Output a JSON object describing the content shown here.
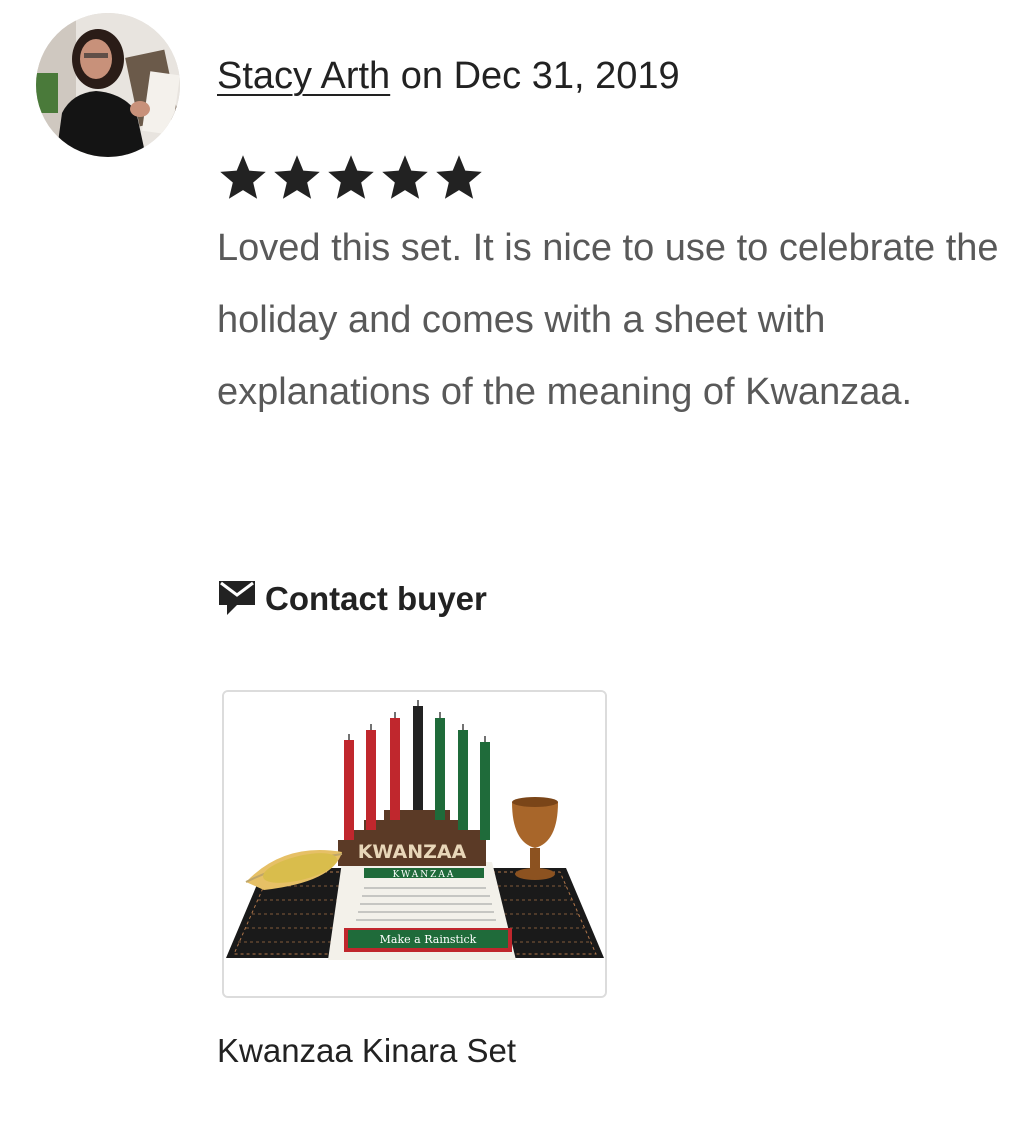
{
  "review": {
    "reviewer_name": "Stacy Arth",
    "date_text": " on Dec 31, 2019",
    "rating": 5,
    "rating_max": 5,
    "text": "Loved this set. It is nice to use to celebrate the holiday and comes with a sheet with explanations of the meaning of Kwanzaa.",
    "contact_label": "Contact buyer",
    "contact_icon": "message-icon"
  },
  "product": {
    "title": "Kwanzaa Kinara Set",
    "image_text": {
      "base_label": "KWANZAA",
      "sheet_header": "KWANZAA",
      "sheet_footer": "Make a Rainstick"
    }
  },
  "colors": {
    "star": "#222222",
    "text_primary": "#222222",
    "text_secondary": "#595959",
    "candle_red": "#c0272d",
    "candle_black": "#222222",
    "candle_green": "#1f6b3a"
  }
}
